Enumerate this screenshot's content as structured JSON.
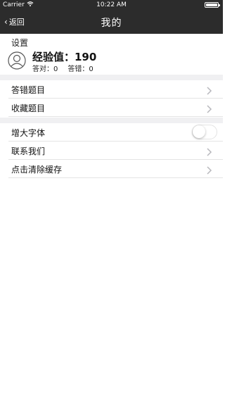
{
  "status_bar": {
    "carrier": "Carrier",
    "time": "10:22 AM"
  },
  "nav": {
    "back_label": "返回",
    "title": "我的"
  },
  "settings": {
    "section_label": "设置"
  },
  "profile": {
    "exp_label": "经验值：190",
    "correct_label": "答对：0",
    "wrong_label": "答错：0"
  },
  "menu": {
    "group1": [
      {
        "label": "答错题目"
      },
      {
        "label": "收藏题目"
      }
    ],
    "group2": {
      "font_toggle_label": "增大字体",
      "font_toggle_on": false,
      "contact_label": "联系我们",
      "clear_cache_label": "点击清除缓存"
    }
  },
  "colors": {
    "bar_bg": "#2c2c2c",
    "divider": "#e4e4e4",
    "section_gap": "#f0f0f2"
  }
}
